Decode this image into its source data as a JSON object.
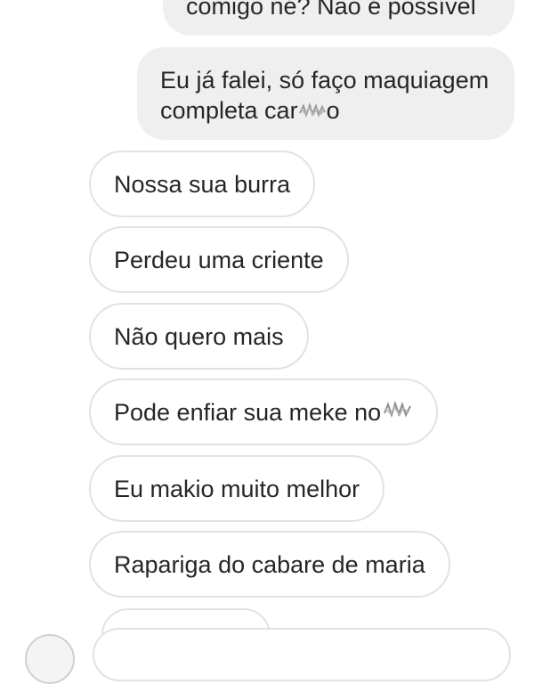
{
  "messages": {
    "sent": [
      {
        "text": "comigo né? Não é possível"
      },
      {
        "line1": "Eu já falei, só faço maquiagem",
        "line2_prefix": "completa car",
        "line2_suffix": "o"
      }
    ],
    "received": [
      {
        "text": "Nossa sua burra"
      },
      {
        "text": "Perdeu uma criente"
      },
      {
        "text": "Não quero mais"
      },
      {
        "text": "Pode enfiar sua meke no"
      },
      {
        "text": "Eu makio muito melhor"
      },
      {
        "text": "Rapariga do cabare de maria"
      }
    ]
  },
  "colors": {
    "sent_bubble": "#efefef",
    "received_border": "#e2e2e2",
    "text": "#262626"
  }
}
